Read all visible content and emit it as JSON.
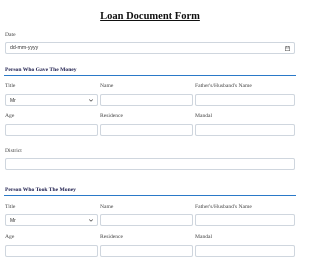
{
  "form": {
    "title": "Loan Document Form"
  },
  "date": {
    "label": "Date",
    "placeholder": "dd-mm-yyyy"
  },
  "giver": {
    "heading": "Person Who Gave The Money",
    "title_label": "Title",
    "title_value": "Mr",
    "name_label": "Name",
    "guardian_label": "Father's/Husband's Name",
    "age_label": "Age",
    "residence_label": "Residence",
    "mandal_label": "Mandal",
    "district_label": "District"
  },
  "taker": {
    "heading": "Person Who Took The Money",
    "title_label": "Title",
    "title_value": "Mr",
    "name_label": "Name",
    "guardian_label": "Father's/Husband's Name",
    "age_label": "Age",
    "residence_label": "Residence",
    "mandal_label": "Mandal"
  },
  "icons": {
    "date": "calendar-icon",
    "select": "chevron-down-icon"
  },
  "colors": {
    "section_rule": "#2a79c8",
    "field_border": "#cfd6de"
  }
}
